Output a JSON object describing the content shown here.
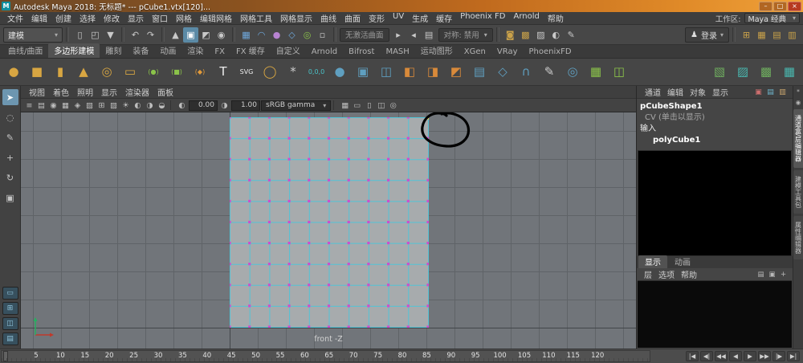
{
  "titlebar": {
    "app_title": "Autodesk Maya 2018: 无标题* --- pCube1.vtx[120]...",
    "minimize": "–",
    "maximize": "□",
    "close": "×"
  },
  "menubar": {
    "items": [
      "文件",
      "编辑",
      "创建",
      "选择",
      "修改",
      "显示",
      "窗口",
      "网格",
      "编辑网格",
      "网格工具",
      "网格显示",
      "曲线",
      "曲面",
      "变形",
      "UV",
      "生成",
      "缓存",
      "Phoenix FD",
      "Arnold",
      "帮助"
    ],
    "workspace_label": "工作区:",
    "workspace_value": "Maya 经典",
    "dropdown_arrow": "▾"
  },
  "toolbar": {
    "menuset": "建模",
    "no_active_surface": "无激活曲面",
    "symmetry": "对称: 禁用",
    "signin": "登录",
    "file_icons": [
      {
        "n": "new-scene-icon",
        "g": "▯"
      },
      {
        "n": "open-scene-icon",
        "g": "◰"
      },
      {
        "n": "save-scene-icon",
        "g": "▼"
      }
    ],
    "undo_icons": [
      {
        "n": "undo-icon",
        "g": "↶"
      },
      {
        "n": "redo-icon",
        "g": "↷"
      }
    ],
    "select_icons": [
      {
        "n": "select-hierarchy-icon",
        "g": "▲"
      },
      {
        "n": "select-object-icon",
        "g": "▣",
        "active": true
      },
      {
        "n": "select-component-icon",
        "g": "◩"
      },
      {
        "n": "highlight-selection-icon",
        "g": "◉"
      }
    ],
    "snap_icons": [
      {
        "n": "snap-grid-icon",
        "g": "▦",
        "c": "#6fa8dc"
      },
      {
        "n": "snap-curve-icon",
        "g": "◠",
        "c": "#6fa8dc"
      },
      {
        "n": "snap-point-icon",
        "g": "●",
        "c": "#b783d1"
      },
      {
        "n": "snap-plane-icon",
        "g": "◇",
        "c": "#6fa8dc"
      },
      {
        "n": "make-live-icon",
        "g": "◎",
        "c": "#8bc34a"
      },
      {
        "n": "snap-rivet-icon",
        "g": "▫",
        "c": "#c9c9c9"
      }
    ],
    "mid_icons": [
      {
        "n": "input-connections-icon",
        "g": "▸"
      },
      {
        "n": "output-connections-icon",
        "g": "◂"
      },
      {
        "n": "construction-history-icon",
        "g": "▤"
      }
    ],
    "history_icons": [
      {
        "n": "render-frame-icon",
        "g": "◙",
        "c": "#caa24a"
      },
      {
        "n": "ipr-render-icon",
        "g": "▩",
        "c": "#caa24a"
      },
      {
        "n": "render-settings-icon",
        "g": "▨",
        "c": "#c9c9c9"
      },
      {
        "n": "hypershade-icon",
        "g": "◐",
        "c": "#c9c9c9"
      },
      {
        "n": "paint-effects-icon",
        "g": "✎",
        "c": "#c9c9c9"
      }
    ],
    "gold_icons": [
      {
        "n": "align-grid-icon",
        "g": "⊞",
        "c": "#caa24a"
      },
      {
        "n": "align-table-icon",
        "g": "▦",
        "c": "#caa24a"
      },
      {
        "n": "layout-rows-icon",
        "g": "▤",
        "c": "#caa24a"
      },
      {
        "n": "layout-cols-icon",
        "g": "▥",
        "c": "#caa24a"
      }
    ]
  },
  "shelf": {
    "active_tab": "多边形建模",
    "tabs": [
      "曲线/曲面",
      "多边形建模",
      "雕刻",
      "装备",
      "动画",
      "渲染",
      "FX",
      "FX 缓存",
      "自定义",
      "Arnold",
      "Bifrost",
      "MASH",
      "运动图形",
      "XGen",
      "VRay",
      "PhoenixFD"
    ],
    "icons": [
      {
        "n": "poly-sphere-icon",
        "g": "●",
        "c": "#d8a642"
      },
      {
        "n": "poly-cube-icon",
        "g": "■",
        "c": "#d8a642"
      },
      {
        "n": "poly-cylinder-icon",
        "g": "▮",
        "c": "#d8a642"
      },
      {
        "n": "poly-cone-icon",
        "g": "▲",
        "c": "#d8a642"
      },
      {
        "n": "poly-torus-icon",
        "g": "◎",
        "c": "#d8a642"
      },
      {
        "n": "poly-plane-icon",
        "g": "▭",
        "c": "#d8a642"
      },
      {
        "n": "live-sphere-bracket-icon",
        "g": "(●)",
        "c": "#8bc34a",
        "small": true
      },
      {
        "n": "live-cube-bracket-icon",
        "g": "(■)",
        "c": "#8bc34a",
        "small": true
      },
      {
        "n": "live-diamond-bracket-icon",
        "g": "(◆)",
        "c": "#e39b3a",
        "small": true
      },
      {
        "n": "type-tool-icon",
        "g": "T",
        "c": "#ececec"
      },
      {
        "n": "svg-tool-icon",
        "g": "SVG",
        "c": "#ececec",
        "small": true
      },
      {
        "n": "sweep-mesh-icon",
        "g": "◯",
        "c": "#d8a642"
      },
      {
        "n": "construction-aid-icon",
        "g": "*",
        "c": "#cccccc"
      },
      {
        "n": "origin-icon",
        "g": "0,0,0",
        "c": "#49c2c8",
        "small": true
      },
      {
        "n": "smooth-mesh-icon",
        "g": "●",
        "c": "#5f9fc0"
      },
      {
        "n": "combine-icon",
        "g": "▣",
        "c": "#5f9fc0"
      },
      {
        "n": "separate-icon",
        "g": "◫",
        "c": "#5f9fc0"
      },
      {
        "n": "boolean-union-icon",
        "g": "◧",
        "c": "#d98a3a"
      },
      {
        "n": "boolean-difference-icon",
        "g": "◨",
        "c": "#d98a3a"
      },
      {
        "n": "boolean-intersect-icon",
        "g": "◩",
        "c": "#d98a3a"
      },
      {
        "n": "extrude-icon",
        "g": "▤",
        "c": "#5f9fc0"
      },
      {
        "n": "bevel-icon",
        "g": "◇",
        "c": "#5f9fc0"
      },
      {
        "n": "bridge-icon",
        "g": "∩",
        "c": "#5f9fc0"
      },
      {
        "n": "multi-cut-icon",
        "g": "✎",
        "c": "#cccccc"
      },
      {
        "n": "target-weld-icon",
        "g": "◎",
        "c": "#5f9fc0"
      },
      {
        "n": "quad-draw-icon",
        "g": "▦",
        "c": "#8bc34a"
      },
      {
        "n": "mirror-icon",
        "g": "◫",
        "c": "#8bc34a"
      }
    ],
    "right_icons": [
      {
        "n": "shelf-green-cubes-icon",
        "g": "▧",
        "c": "#6fae5f"
      },
      {
        "n": "shelf-teal-cubes-icon",
        "g": "▨",
        "c": "#49b8b0"
      },
      {
        "n": "shelf-green-grid-icon",
        "g": "▩",
        "c": "#6fae5f"
      },
      {
        "n": "shelf-teal-grid-icon",
        "g": "▦",
        "c": "#49b8b0"
      }
    ]
  },
  "toolbox": {
    "tools": [
      {
        "n": "select-tool",
        "g": "➤",
        "active": true
      },
      {
        "n": "lasso-select-tool",
        "g": "◌"
      },
      {
        "n": "paint-select-tool",
        "g": "✎"
      },
      {
        "n": "move-tool",
        "g": "+"
      },
      {
        "n": "rotate-tool",
        "g": "↻"
      },
      {
        "n": "scale-tool",
        "g": "▣"
      }
    ],
    "layouts": [
      {
        "n": "layout-single-pane-button",
        "g": "▭"
      },
      {
        "n": "layout-four-pane-button",
        "g": "⊞"
      },
      {
        "n": "layout-persp-outliner-button",
        "g": "◫"
      },
      {
        "n": "layout-split-button",
        "g": "▤"
      }
    ]
  },
  "panel_menu": {
    "items": [
      "视图",
      "着色",
      "照明",
      "显示",
      "渲染器",
      "面板"
    ]
  },
  "viewport": {
    "toolbar_icons": [
      {
        "n": "panel-menu-icon",
        "g": "≡"
      },
      {
        "n": "select-camera-icon",
        "g": "▤"
      },
      {
        "n": "lock-camera-icon",
        "g": "◉"
      },
      {
        "n": "camera-attributes-icon",
        "g": "▦"
      },
      {
        "n": "bookmark-icon",
        "g": "◈"
      },
      {
        "n": "image-plane-icon",
        "g": "▧"
      },
      {
        "n": "pan-zoom-icon",
        "g": "⊞"
      },
      {
        "n": "oversampling-icon",
        "g": "▨"
      },
      {
        "n": "lighting-icon",
        "g": "☀"
      },
      {
        "n": "shadows-icon",
        "g": "◐"
      },
      {
        "n": "ambient-occlusion-icon",
        "g": "◑"
      },
      {
        "n": "motion-blur-icon",
        "g": "◒"
      }
    ],
    "toolbar_icons2": [
      {
        "n": "grid-toggle-icon",
        "g": "▦"
      },
      {
        "n": "film-gate-icon",
        "g": "▭"
      },
      {
        "n": "resolution-gate-icon",
        "g": "▯"
      },
      {
        "n": "gate-mask-icon",
        "g": "◫"
      },
      {
        "n": "isolate-select-icon",
        "g": "◎"
      }
    ],
    "exposure_icon": "◐",
    "gamma_icon": "◑",
    "exposure": "0.00",
    "gamma": "1.00",
    "view_transform": "sRGB gamma",
    "camera_label": "front -Z",
    "cube": {
      "cols": 10,
      "rows": 10,
      "face_color": "#a7abad",
      "edge_color": "#53c3d6",
      "vertex_color": "#cc4fcc",
      "selected_vertex_color": "#ffe94f",
      "selected_vertex": "top-right-corner",
      "annotation": "hand-drawn-black-circle"
    }
  },
  "channel_box": {
    "menus": [
      "通道",
      "编辑",
      "对象",
      "显示"
    ],
    "dock_icons": [
      {
        "n": "dock-toggle-red-icon",
        "g": "▣",
        "c": "#cf6f6f"
      },
      {
        "n": "dock-toggle-teal-icon",
        "g": "▤",
        "c": "#6fb7cf"
      },
      {
        "n": "dock-toggle-gold-icon",
        "g": "▥",
        "c": "#cfa96f"
      }
    ],
    "shape_name": "pCubeShape1",
    "cv_label": "CV (单击以显示)",
    "inputs_label": "输入",
    "input_node": "polyCube1"
  },
  "layer_editor": {
    "tabs": [
      {
        "label": "显示",
        "active": true
      },
      {
        "label": "动画",
        "active": false
      }
    ],
    "menus": [
      "层",
      "选项",
      "帮助"
    ],
    "buttons": [
      {
        "n": "layer-options-icon",
        "g": "▤"
      },
      {
        "n": "new-empty-layer-icon",
        "g": "▣"
      },
      {
        "n": "new-layer-from-selected-icon",
        "g": "+"
      }
    ]
  },
  "right_strip": {
    "icons": [
      {
        "n": "strip-settings-icon",
        "g": "*"
      },
      {
        "n": "strip-pin-icon",
        "g": "◉"
      }
    ],
    "tabs": [
      {
        "label": "通道盒/层编辑器",
        "active": true
      },
      {
        "label": "建模工具包",
        "active": false
      },
      {
        "label": "属性编辑器",
        "active": false
      }
    ]
  },
  "timeline": {
    "ticks": [
      "5",
      "10",
      "15",
      "20",
      "25",
      "30",
      "35",
      "40",
      "45",
      "50",
      "55",
      "60",
      "65",
      "70",
      "75",
      "80",
      "85",
      "90",
      "95",
      "100",
      "105",
      "110",
      "115",
      "120"
    ]
  },
  "transport": {
    "buttons": [
      {
        "n": "go-to-start-button",
        "g": "|◀"
      },
      {
        "n": "prev-key-button",
        "g": "◀|"
      },
      {
        "n": "prev-frame-button",
        "g": "◀◀"
      },
      {
        "n": "play-backward-button",
        "g": "◀"
      },
      {
        "n": "play-forward-button",
        "g": "▶"
      },
      {
        "n": "next-frame-button",
        "g": "▶▶"
      },
      {
        "n": "next-key-button",
        "g": "|▶"
      },
      {
        "n": "go-to-end-button",
        "g": "▶|"
      }
    ]
  }
}
